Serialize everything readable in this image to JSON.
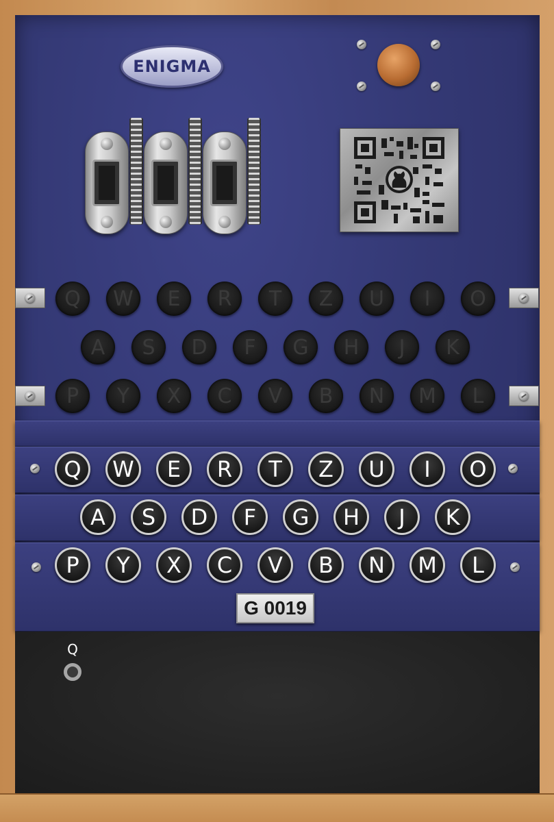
{
  "logo": {
    "text": "ENIGMA"
  },
  "lampboard": {
    "rows": [
      [
        "Q",
        "W",
        "E",
        "R",
        "T",
        "Z",
        "U",
        "I",
        "O"
      ],
      [
        "A",
        "S",
        "D",
        "F",
        "G",
        "H",
        "J",
        "K"
      ],
      [
        "P",
        "Y",
        "X",
        "C",
        "V",
        "B",
        "N",
        "M",
        "L"
      ]
    ]
  },
  "keyboard": {
    "rows": [
      [
        "Q",
        "W",
        "E",
        "R",
        "T",
        "Z",
        "U",
        "I",
        "O"
      ],
      [
        "A",
        "S",
        "D",
        "F",
        "G",
        "H",
        "J",
        "K"
      ],
      [
        "P",
        "Y",
        "X",
        "C",
        "V",
        "B",
        "N",
        "M",
        "L"
      ]
    ]
  },
  "counter": {
    "text": "G 0019"
  },
  "output": {
    "letters": [
      "Q"
    ]
  },
  "colors": {
    "panel": "#343975",
    "wood": "#c89259",
    "output_bg": "#222222"
  }
}
